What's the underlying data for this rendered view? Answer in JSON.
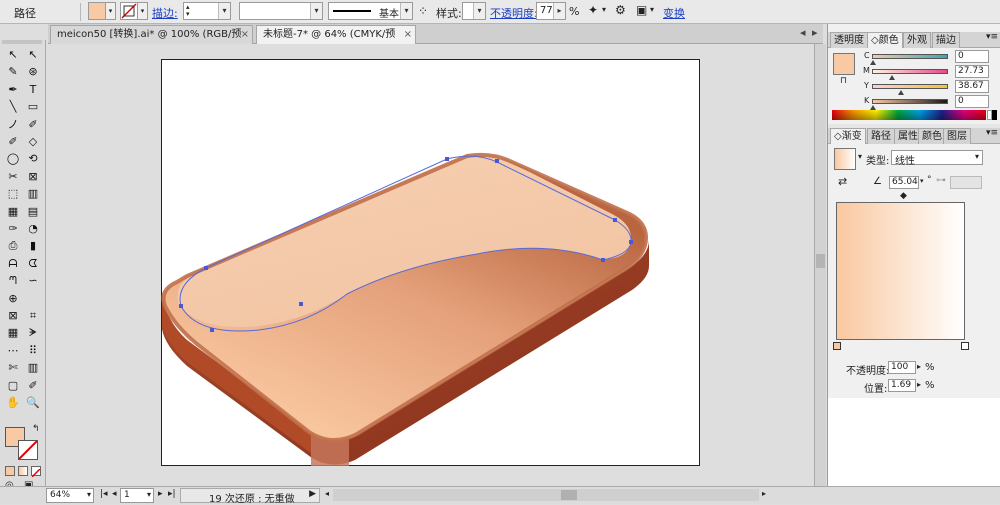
{
  "control_bar": {
    "selection_label": "路径",
    "stroke_link": "描边:",
    "stroke_weight": "",
    "profile_value": "基本",
    "style_label": "样式:",
    "opacity_link": "不透明度:",
    "opacity_value": "77",
    "percent": "%",
    "transform_link": "变换"
  },
  "doc_tabs": [
    {
      "label": "meicon50 [转换].ai* @ 100% (RGB/预览)",
      "close": "×"
    },
    {
      "label": "未标题-7* @ 64% (CMYK/预览)",
      "close": "×"
    }
  ],
  "tools": {
    "rows": [
      [
        "↖",
        "↖"
      ],
      [
        "✎",
        "⊛"
      ],
      [
        "✒",
        "T"
      ],
      [
        "╲",
        "▭"
      ],
      [
        "ノ",
        "✐"
      ],
      [
        "✐",
        "◇"
      ],
      [
        "◯",
        "⟲"
      ],
      [
        "✂",
        "⊠"
      ],
      [
        "⬚",
        "▥"
      ],
      [
        "▦",
        "▤"
      ],
      [
        "✑",
        "◔"
      ],
      [
        "⎙",
        "▮"
      ],
      [
        "ᗩ",
        "ᗧ"
      ],
      [
        "ᘉ",
        "∽"
      ],
      [
        "⊕",
        ""
      ],
      [
        "⊠",
        "⌗"
      ],
      [
        "▦",
        "ᗚ"
      ],
      [
        "⋯",
        "⠿"
      ],
      [
        "✄",
        "▥"
      ],
      [
        "▢",
        "✐"
      ],
      [
        "✋",
        "🔍"
      ]
    ]
  },
  "color_panel": {
    "tabs": [
      "透明度",
      "◇颜色",
      "外观",
      "描边"
    ],
    "c_label": "C",
    "m_label": "M",
    "y_label": "Y",
    "k_label": "K",
    "c_value": "0",
    "m_value": "27.73",
    "y_value": "38.67",
    "k_value": "0",
    "fill_color": "#f7c9a4"
  },
  "gradient_panel": {
    "tabs": [
      "◇渐变",
      "路径",
      "属性",
      "颜色",
      "图层"
    ],
    "type_label": "类型:",
    "type_value": "线性",
    "angle_value": "65.04",
    "degree": "°",
    "opacity_label": "不透明度:",
    "opacity_value": "100",
    "opacity_pct": "%",
    "location_label": "位置:",
    "location_value": "1.69",
    "location_pct": "%",
    "start_color": "#f9c8a0",
    "end_color": "#ffffff"
  },
  "status_bar": {
    "zoom": "64%",
    "page": "1",
    "undo_text": "19 次还原 : 无重做"
  },
  "colors": {
    "accent": "#1a3fc0",
    "body_light": "#f7c49c",
    "body_dark": "#c27045",
    "side_dark": "#9b3a20"
  }
}
